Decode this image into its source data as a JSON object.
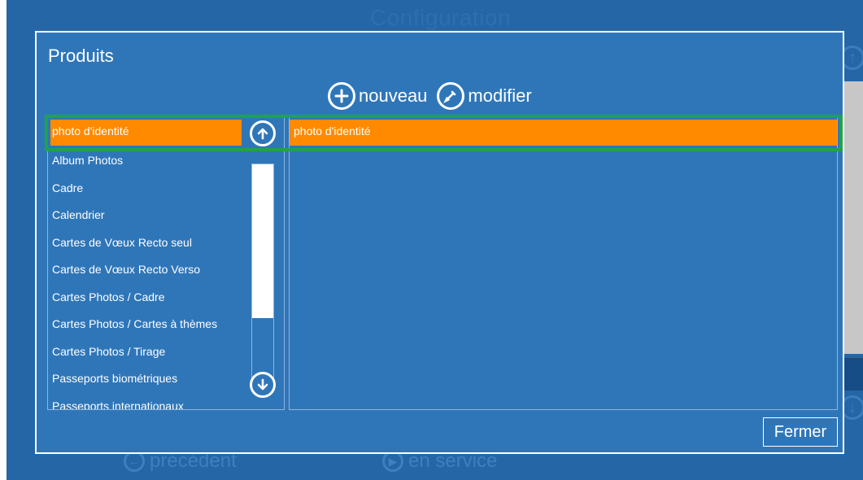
{
  "background": {
    "title": "Configuration",
    "nav": {
      "prev_label": "précédent",
      "service_label": "en service"
    }
  },
  "dialog": {
    "title": "Produits",
    "toolbar": {
      "new_label": "nouveau",
      "edit_label": "modifier"
    },
    "left_list": {
      "selected": "photo d'identité",
      "items": [
        "Album Photos",
        "Cadre",
        "Calendrier",
        "Cartes de Vœux Recto seul",
        "Cartes de Vœux Recto Verso",
        "Cartes Photos / Cadre",
        "Cartes Photos / Cartes à thèmes",
        "Cartes Photos / Tirage",
        "Passeports biométriques",
        "Passeports internationaux"
      ],
      "scroll_position": 0.69
    },
    "right_panel": {
      "selected": "photo d'identité"
    },
    "close_label": "Fermer"
  },
  "colors": {
    "app_background": "#2566a6",
    "dialog_background": "#2f76b9",
    "selection": "#ff8a00",
    "highlight_frame": "#1fa34a"
  }
}
